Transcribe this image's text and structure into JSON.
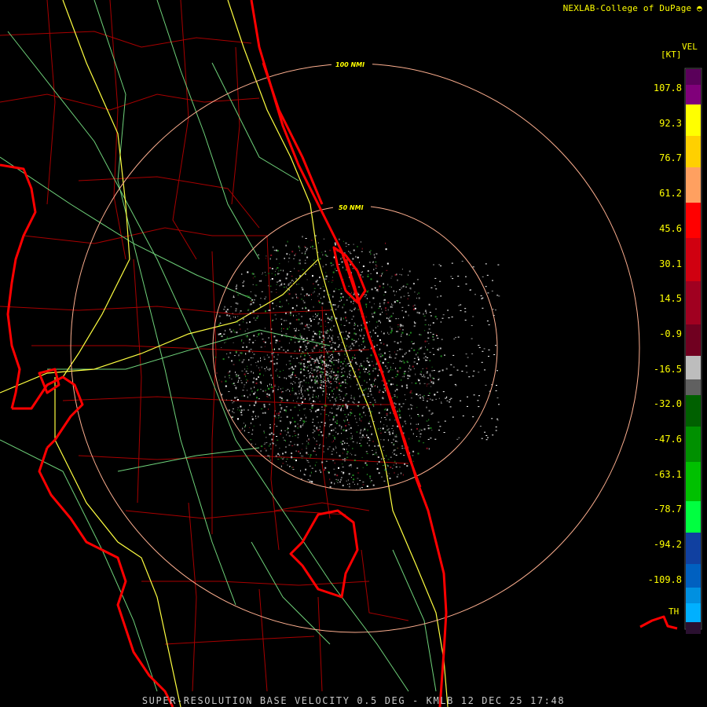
{
  "header": {
    "credit": "NEXLAB-College of DuPage",
    "logo_icon": "cod-logo-icon"
  },
  "legend": {
    "units": "[KT]",
    "product": "VEL",
    "ticks": [
      "107.8",
      "92.3",
      "76.7",
      "61.2",
      "45.6",
      "30.1",
      "14.5",
      "-0.9",
      "-16.5",
      "-32.0",
      "-47.6",
      "-63.1",
      "-78.7",
      "-94.2",
      "-109.8"
    ],
    "threshold_label": "TH",
    "bands": [
      {
        "color": "#5a005a"
      },
      {
        "color": "#80007a"
      },
      {
        "color": "#ffff00"
      },
      {
        "color": "#ffd000"
      },
      {
        "color": "#ffa060"
      },
      {
        "color": "#ff0000"
      },
      {
        "color": "#d00010"
      },
      {
        "color": "#a00020"
      },
      {
        "color": "#700020"
      },
      {
        "color": "#bdbdbd"
      },
      {
        "color": "#606060"
      },
      {
        "color": "#006000"
      },
      {
        "color": "#009000"
      },
      {
        "color": "#00c000"
      },
      {
        "color": "#00ff40"
      },
      {
        "color": "#1040a0"
      },
      {
        "color": "#0060c0"
      },
      {
        "color": "#0090e0"
      },
      {
        "color": "#00b0ff"
      },
      {
        "color": "#2a1030"
      }
    ]
  },
  "rings": {
    "inner_label": "50 NMI",
    "outer_label": "100 NMI"
  },
  "footer": {
    "title": "SUPER-RESOLUTION BASE VELOCITY 0.5 DEG - KMLB 12 DEC 25 17:48"
  },
  "colors": {
    "coast": "#ff0000",
    "county": "#b40000",
    "road_green": "#6fd27a",
    "road_yellow": "#ffff40",
    "ring": "#ffb090"
  }
}
